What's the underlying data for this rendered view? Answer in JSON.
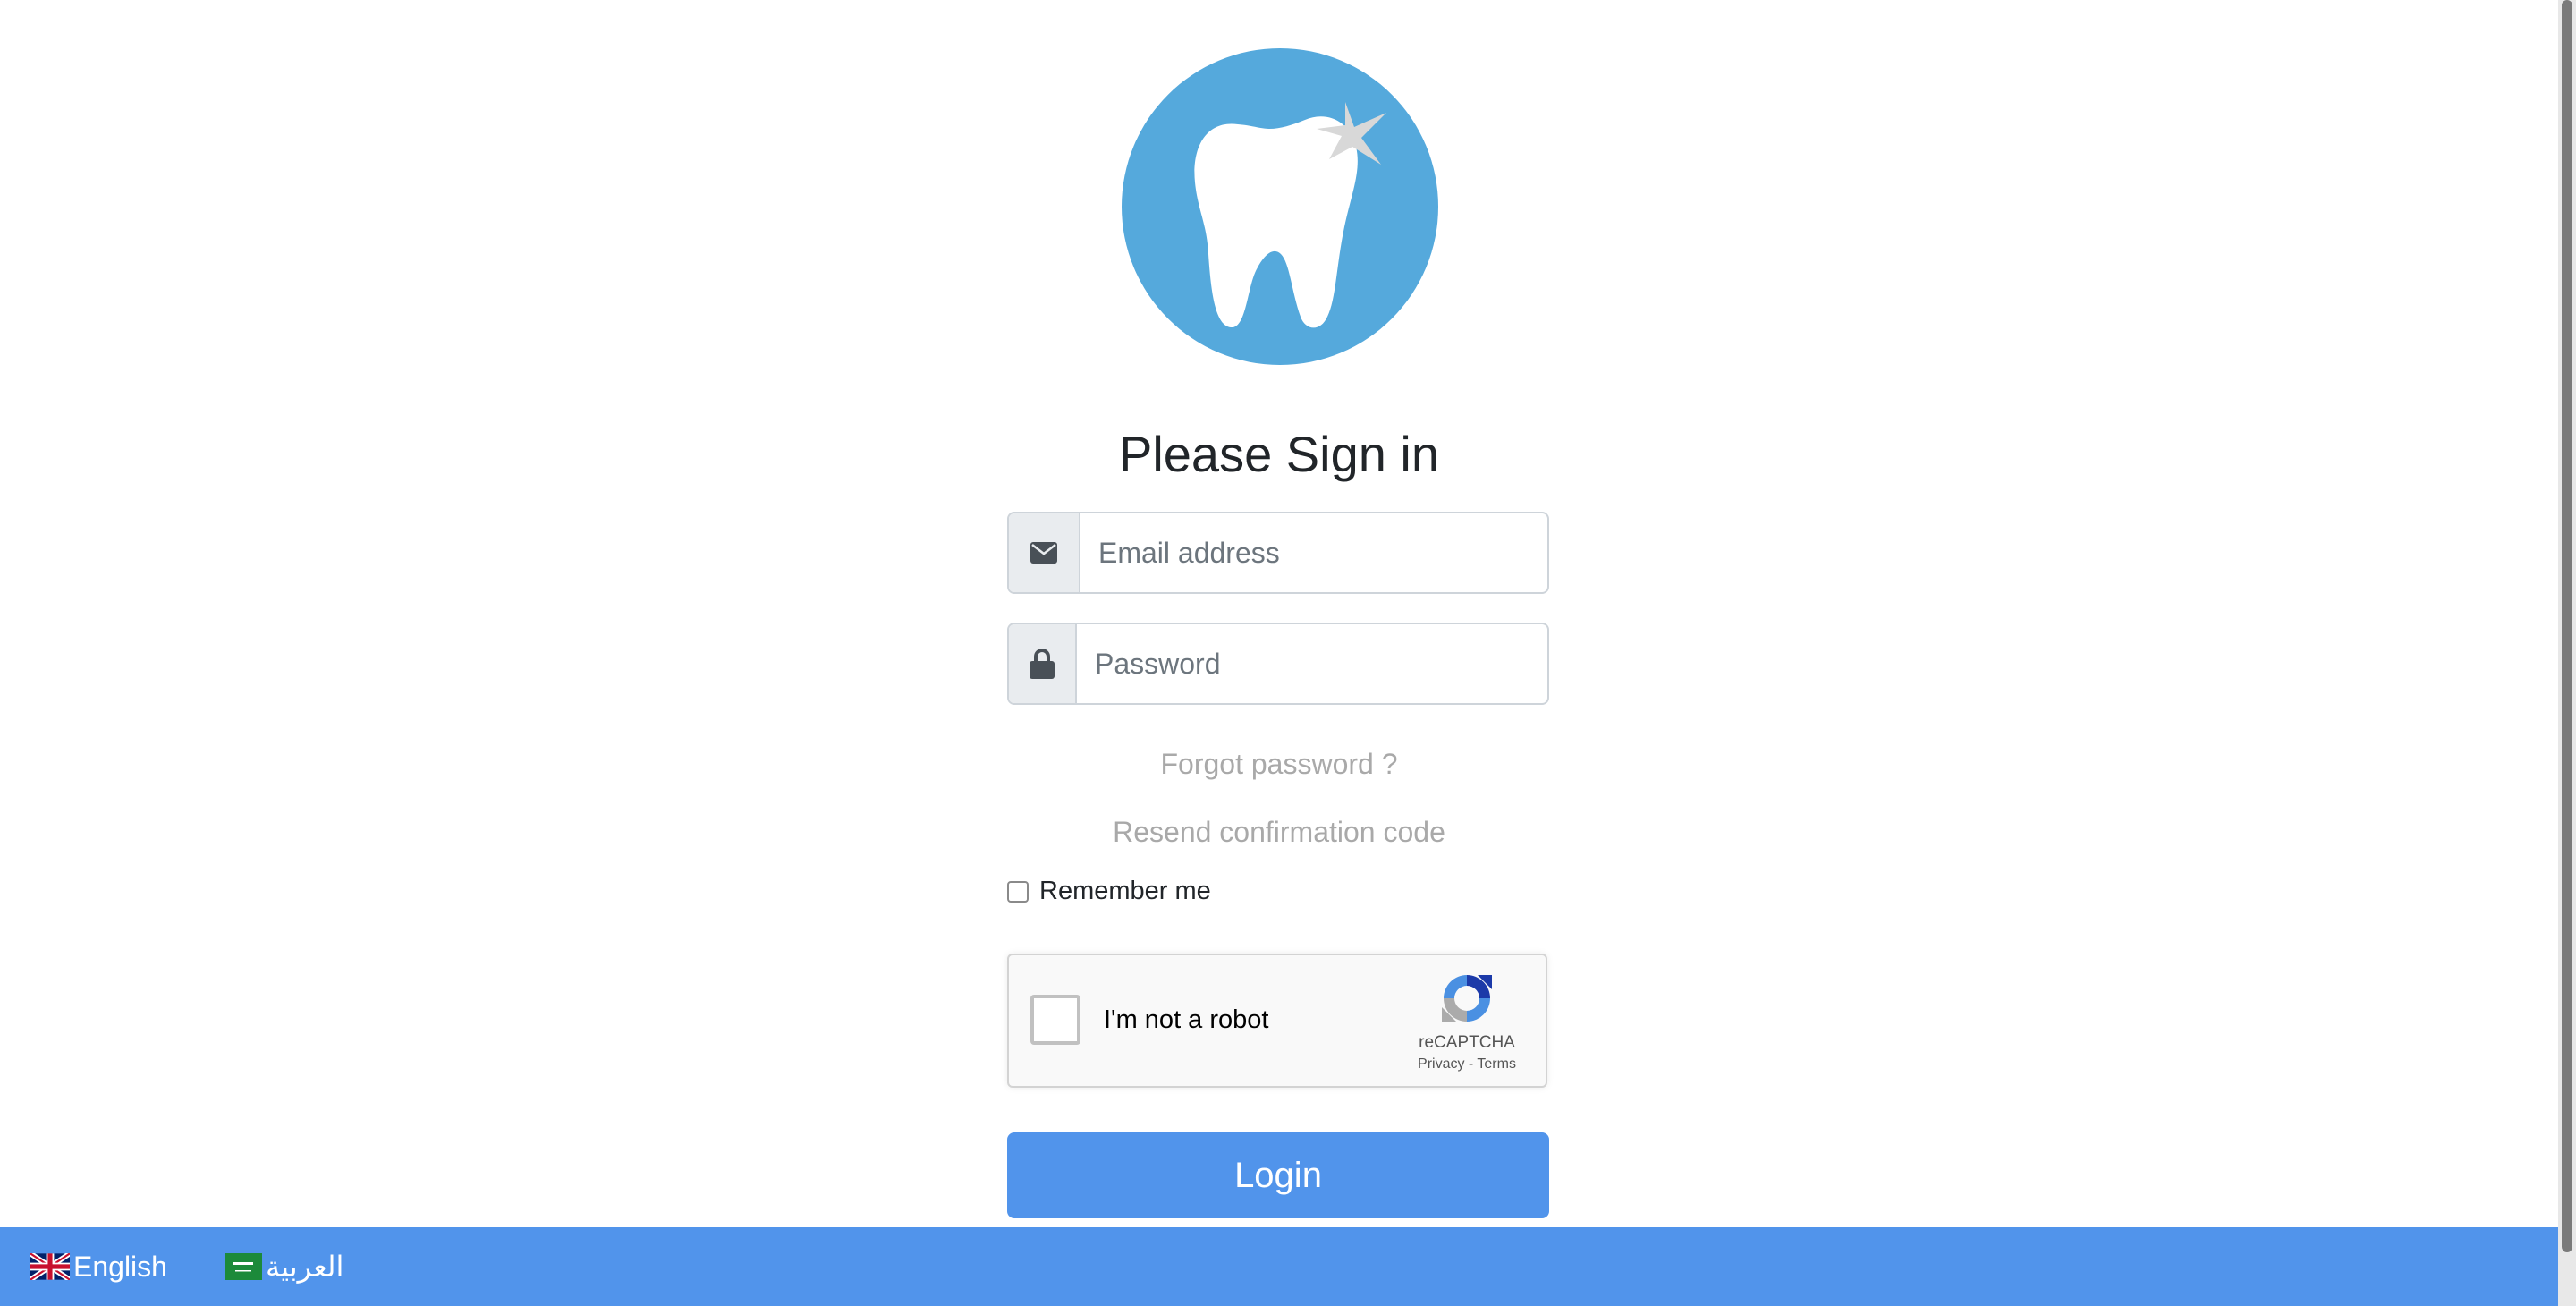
{
  "logo": {
    "icon": "tooth-logo-icon",
    "color": "#55a9dc"
  },
  "title": "Please Sign in",
  "email": {
    "icon": "envelope-icon",
    "placeholder": "Email address",
    "value": ""
  },
  "password": {
    "icon": "lock-icon",
    "placeholder": "Password",
    "value": ""
  },
  "links": {
    "forgot": "Forgot password ?",
    "resend": "Resend confirmation code"
  },
  "remember": {
    "label": "Remember me",
    "checked": false
  },
  "captcha": {
    "label": "I'm not a robot",
    "brand": "reCAPTCHA",
    "privacy": "Privacy",
    "separator": "-",
    "terms": "Terms"
  },
  "login": {
    "label": "Login",
    "color": "#5194eb"
  },
  "footer": {
    "languages": [
      {
        "label": "English",
        "icon": "uk-flag-icon"
      },
      {
        "label": "العربية",
        "icon": "saudi-flag-icon"
      }
    ]
  }
}
